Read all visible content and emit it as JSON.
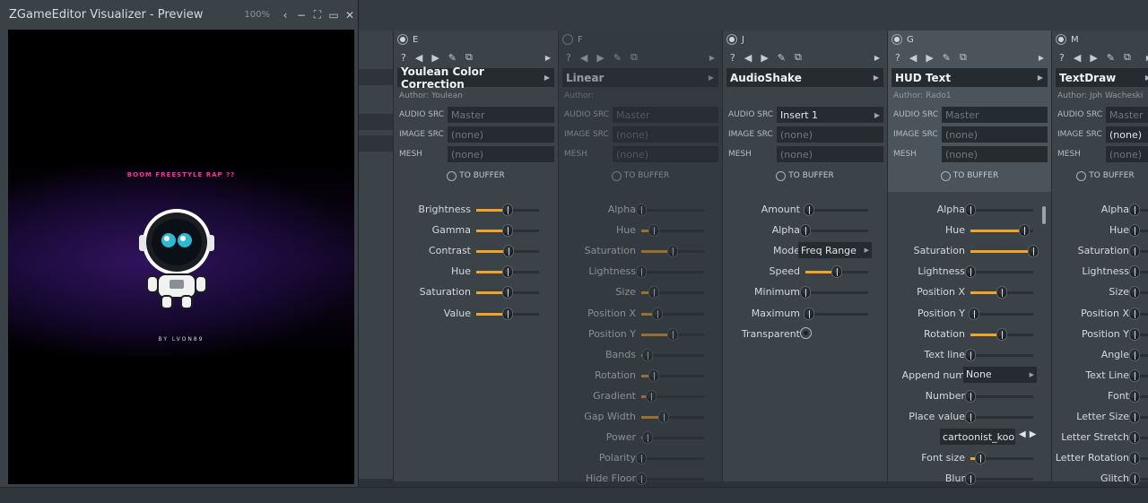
{
  "preview": {
    "title": "ZGameEditor Visualizer - Preview",
    "zoom": "100%",
    "headline": "BOOM FREESTYLE RAP ??",
    "byline": "BY LVON89"
  },
  "common": {
    "audio_src_label": "AUDIO SRC",
    "image_src_label": "IMAGE SRC",
    "mesh_label": "MESH",
    "to_buffer": "TO BUFFER",
    "help": "?"
  },
  "columns": [
    {
      "letter": "E",
      "name": "Youlean Color Correction",
      "author": "Author: Youlean",
      "audio_src": "Master",
      "image_src": "(none)",
      "mesh": "(none)",
      "params": [
        {
          "label": "Brightness",
          "value": 0.5
        },
        {
          "label": "Gamma",
          "value": 0.5
        },
        {
          "label": "Contrast",
          "value": 0.52
        },
        {
          "label": "Hue",
          "value": 0.5
        },
        {
          "label": "Saturation",
          "value": 0.5
        },
        {
          "label": "Value",
          "value": 0.5
        }
      ]
    },
    {
      "letter": "F",
      "name": "Linear",
      "author": "Author:",
      "audio_src": "Master",
      "image_src": "(none)",
      "mesh": "(none)",
      "params": [
        {
          "label": "Alpha",
          "value": 0.0
        },
        {
          "label": "Hue",
          "value": 0.2
        },
        {
          "label": "Saturation",
          "value": 0.5
        },
        {
          "label": "Lightness",
          "value": 0.0
        },
        {
          "label": "Size",
          "value": 0.2
        },
        {
          "label": "Position X",
          "value": 0.25
        },
        {
          "label": "Position Y",
          "value": 0.5
        },
        {
          "label": "Bands",
          "value": 0.1
        },
        {
          "label": "Rotation",
          "value": 0.2
        },
        {
          "label": "Gradient",
          "value": 0.15
        },
        {
          "label": "Gap Width",
          "value": 0.35
        },
        {
          "label": "Power",
          "value": 0.1
        },
        {
          "label": "Polarity",
          "value": 0.0
        },
        {
          "label": "Hide Floor",
          "value": 0.0
        }
      ]
    },
    {
      "letter": "J",
      "name": "AudioShake",
      "author": "",
      "audio_src": "Insert 1",
      "image_src": "(none)",
      "mesh": "(none)",
      "params": [
        {
          "label": "Amount",
          "value": 0.05
        },
        {
          "label": "Alpha",
          "value": 0.0
        },
        {
          "label": "Mode",
          "dropdown": "Freq Range"
        },
        {
          "label": "Speed",
          "value": 0.5
        },
        {
          "label": "Minimum",
          "value": 0.0
        },
        {
          "label": "Maximum",
          "value": 0.05
        },
        {
          "label": "Transparent",
          "toggle": true
        }
      ]
    },
    {
      "letter": "G",
      "name": "HUD Text",
      "author": "Author: Rado1",
      "audio_src": "Master",
      "image_src": "(none)",
      "mesh": "(none)",
      "params": [
        {
          "label": "Alpha",
          "value": 0.0
        },
        {
          "label": "Hue",
          "value": 0.85
        },
        {
          "label": "Saturation",
          "value": 1.0
        },
        {
          "label": "Lightness",
          "value": 0.0
        },
        {
          "label": "Position X",
          "value": 0.5
        },
        {
          "label": "Position Y",
          "value": 0.05
        },
        {
          "label": "Rotation",
          "value": 0.5
        },
        {
          "label": "Text line",
          "value": 0.0
        },
        {
          "label": "Append num",
          "dropdown": "None"
        },
        {
          "label": "Number",
          "value": 0.0
        },
        {
          "label": "Place value",
          "value": 0.0
        },
        {
          "label": "Font",
          "fontbox": "cartoonist_koo.."
        },
        {
          "label": "Font size",
          "value": 0.15
        },
        {
          "label": "Blur",
          "value": 0.0
        }
      ]
    },
    {
      "letter": "M",
      "name": "TextDraw",
      "author": "Author: Jph Wacheski",
      "audio_src": "Master",
      "image_src": "(none)",
      "mesh": "(none)",
      "params": [
        {
          "label": "Alpha",
          "value": 0.0
        },
        {
          "label": "Hue",
          "value": 0.0
        },
        {
          "label": "Saturation",
          "value": 0.0
        },
        {
          "label": "Lightness",
          "value": 0.0
        },
        {
          "label": "Size",
          "value": 0.0
        },
        {
          "label": "Position X",
          "value": 0.0
        },
        {
          "label": "Position Y",
          "value": 0.0
        },
        {
          "label": "Angle",
          "value": 0.0
        },
        {
          "label": "Text Line",
          "value": 0.0
        },
        {
          "label": "Font",
          "value": 0.0
        },
        {
          "label": "Letter Size",
          "value": 0.0
        },
        {
          "label": "Letter Stretch",
          "value": 0.0
        },
        {
          "label": "Letter Rotation",
          "value": 0.0
        },
        {
          "label": "Glitch",
          "value": 0.0
        }
      ]
    }
  ],
  "colors": {
    "accent": "#f0a428",
    "panel": "#3b4349",
    "field": "#262b30"
  }
}
